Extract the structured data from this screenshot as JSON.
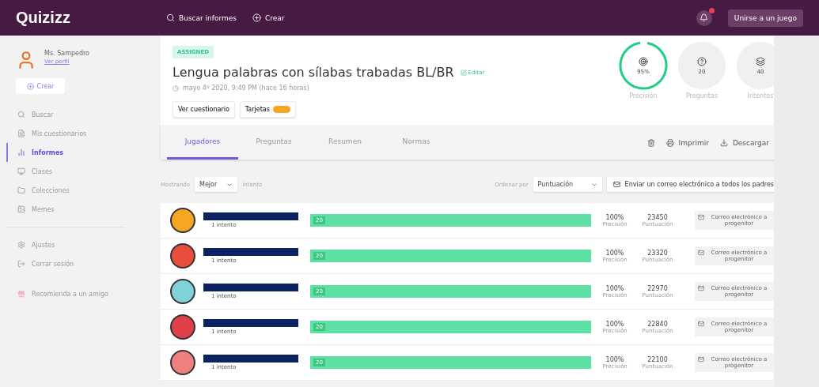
{
  "topbar": {
    "logo": "Quizizz",
    "nav": [
      {
        "label": "Buscar informes",
        "kind": "search"
      },
      {
        "label": "Crear",
        "kind": "plus"
      }
    ],
    "notification": true,
    "join_button": "Unirse a un juego"
  },
  "sidebar": {
    "user": {
      "name": "Ms. Sampedro",
      "link": "Ver perfil"
    },
    "create_button": "Crear",
    "items": [
      {
        "label": "Buscar",
        "selected": false
      },
      {
        "label": "Mis cuestionarios",
        "selected": false
      },
      {
        "label": "Informes",
        "selected": true
      },
      {
        "label": "Clases",
        "selected": false
      },
      {
        "label": "Colecciones",
        "selected": false
      },
      {
        "label": "Memes",
        "selected": false
      }
    ],
    "bottom_items": [
      {
        "label": "Ajustes"
      },
      {
        "label": "Cerrar sesión"
      }
    ],
    "refer": "Recomienda a un amigo"
  },
  "report": {
    "status": "ASSIGNED",
    "title": "Lengua palabras con sílabas trabadas BL/BR",
    "edit": "Editar",
    "date": "mayo 4º 2020, 9:49 PM (hace 16 horas)",
    "buttons": [
      "Ver cuestionario",
      "Tarjetas"
    ],
    "stats": [
      {
        "value": "95%",
        "label": "Precisión",
        "kind": "accuracy",
        "level": 0.95
      },
      {
        "value": "20",
        "label": "Preguntas",
        "kind": "questions"
      },
      {
        "value": "40",
        "label": "Intentos",
        "kind": "attempts"
      }
    ]
  },
  "tabs": [
    {
      "label": "Jugadores",
      "selected": true
    },
    {
      "label": "Preguntas",
      "selected": false
    },
    {
      "label": "Resumen",
      "selected": false
    },
    {
      "label": "Normas",
      "selected": false
    }
  ],
  "actions": [
    "Imprimir",
    "Descargar"
  ],
  "filters": {
    "showing_label": "Mostrando",
    "showing_value": "Mejor",
    "showing_suffix": "intento",
    "sort_label": "Ordenar por",
    "sort_value": "Puntuación",
    "email_all": "Enviar un correo electrónico a todos los padres"
  },
  "players": [
    {
      "attempts": "1 intento",
      "count": "20",
      "level": 1,
      "accuracy": "100%",
      "accuracy_label": "Precisión",
      "score": "23450",
      "score_label": "Puntuación",
      "email": "Correo electrónico a progenitor",
      "color": "#f5a623"
    },
    {
      "attempts": "1 intento",
      "count": "20",
      "level": 1,
      "accuracy": "100%",
      "accuracy_label": "Precisión",
      "score": "23320",
      "score_label": "Puntuación",
      "email": "Correo electrónico a progenitor",
      "color": "#e94e3c"
    },
    {
      "attempts": "1 intento",
      "count": "20",
      "level": 1,
      "accuracy": "100%",
      "accuracy_label": "Precisión",
      "score": "22970",
      "score_label": "Puntuación",
      "email": "Correo electrónico a progenitor",
      "color": "#7fd3d8"
    },
    {
      "attempts": "1 intento",
      "count": "20",
      "level": 1,
      "accuracy": "100%",
      "accuracy_label": "Precisión",
      "score": "22840",
      "score_label": "Puntuación",
      "email": "Correo electrónico a progenitor",
      "color": "#e0404a"
    },
    {
      "attempts": "1 intento",
      "count": "20",
      "level": 1,
      "accuracy": "100%",
      "accuracy_label": "Precisión",
      "score": "22100",
      "score_label": "Puntuación",
      "email": "Correo electrónico a progenitor",
      "color": "#f08080"
    }
  ]
}
